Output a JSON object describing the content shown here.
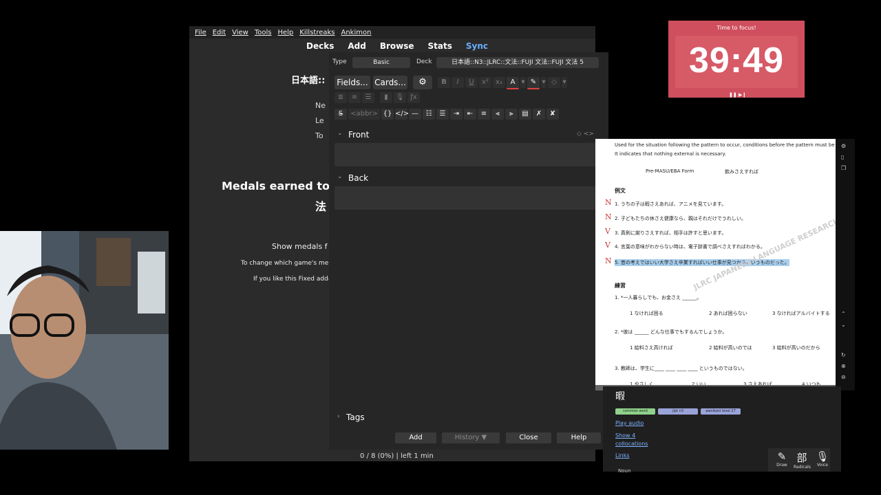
{
  "anki": {
    "menu": [
      "File",
      "Edit",
      "View",
      "Tools",
      "Help",
      "Killstreaks",
      "Ankimon"
    ],
    "toolbar": {
      "decks": "Decks",
      "add": "Add",
      "browse": "Browse",
      "stats": "Stats",
      "sync": "Sync"
    },
    "deck_title": "日本語::",
    "stats": {
      "new": "Ne",
      "learn": "Le",
      "to_review": "To"
    },
    "medals_title": "Medals earned to",
    "medals_title2": "法",
    "show_medals": "Show medals f",
    "change_which": "To change which game's me",
    "if_you_like": "If you like this Fixed add-",
    "footer_status": "0 / 8 (0%) | left 1 min"
  },
  "add_dialog": {
    "type_label": "Type",
    "type_value": "Basic",
    "deck_label": "Deck",
    "deck_value": "日本語::N3::JLRC::文法::FUJI 文法::FUJI 文法 5",
    "fields_button": "Fields...",
    "cards_button": "Cards...",
    "abbr_button": "<abbr>",
    "front_label": "Front",
    "back_label": "Back",
    "tags_label": "Tags",
    "buttons": {
      "add": "Add",
      "history": "History ▼",
      "close": "Close",
      "help": "Help"
    }
  },
  "timer": {
    "label": "Time to focus!",
    "value": "39:49",
    "controls": "❚❚ ▶❙"
  },
  "pdf": {
    "intro1": "Used for the situation following the pattern to occur, conditions before the pattern must be reali",
    "intro2": "It indicates that nothing external is necessary.",
    "form_label": "Pre-MASU/EBA Form",
    "form_example": "飲みさえすれば",
    "section_examples": "例文",
    "examples": [
      "1. うちの子は暇さえあれば、アニメを見ています。",
      "2. 子どもたちの休さえ健康なら、親はそれだけでうれしい。",
      "3. 真剣に謝りさえすれば、相手は許すと思います。",
      "4. 言葉の意味がわからない時は、電子辞書で調べさえすればわかる。",
      "5. 昔の考えではいい大学さえ卒業すればいい仕事が見つかるというものだった。"
    ],
    "marks": [
      "N",
      "N",
      "V",
      "V",
      "N"
    ],
    "section_practice": "練習",
    "q1": "1. *一人暮らしでも、お金さえ ______。",
    "q1_opts": [
      "1 なければ困る",
      "2 あれば困らない",
      "3 なければアルバイトする"
    ],
    "q2": "2. *彼は ______ どんな仕事でもするんでしょうか。",
    "q2_opts": [
      "1 給料さえ高ければ",
      "2 給料が高いのでは",
      "3 給料が高いのだから"
    ],
    "q3": "3. 教師は、学生に____ ____ ____ ____ というものではない。",
    "q3_opts": [
      "1 やさしく",
      "2 いい",
      "3 さえあれば",
      "4 いつも"
    ],
    "watermark": "JLRC JAPANESE LANGUAGE RESEARCH CENTER"
  },
  "dict": {
    "word": "暇",
    "tags": [
      "common word",
      "jlpt n3",
      "wanikani level 27"
    ],
    "tag_colors": [
      "#8fd18a",
      "#9aa3d8",
      "#9aa3d8"
    ],
    "links": [
      "Play audio",
      "Show 4",
      "collocations",
      "Links"
    ],
    "cut": "Noun",
    "tools": [
      "Draw",
      "Radicals",
      "Voice"
    ],
    "tool_icons": [
      "✎",
      "部",
      "🎙"
    ]
  }
}
